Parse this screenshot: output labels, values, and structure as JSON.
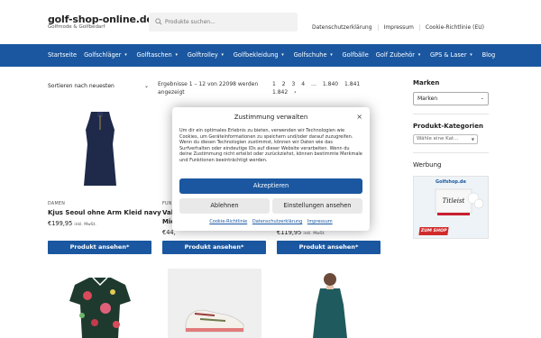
{
  "header": {
    "logo": "golf-shop-online.de",
    "tagline": "Golfmode & Golfbedarf",
    "search_placeholder": "Produkte suchen...",
    "links": [
      "Datenschutzerklärung",
      "Impressum",
      "Cookie-Richtlinie (EU)"
    ]
  },
  "nav": {
    "items": [
      {
        "label": "Startseite",
        "has_dropdown": false
      },
      {
        "label": "Golfschläger",
        "has_dropdown": true
      },
      {
        "label": "Golftaschen",
        "has_dropdown": true
      },
      {
        "label": "Golftrolley",
        "has_dropdown": true
      },
      {
        "label": "Golfbekleidung",
        "has_dropdown": true
      },
      {
        "label": "Golfschuhe",
        "has_dropdown": true
      },
      {
        "label": "Golfbälle",
        "has_dropdown": false
      },
      {
        "label": "Golf Zubehör",
        "has_dropdown": true
      },
      {
        "label": "GPS & Laser",
        "has_dropdown": true
      },
      {
        "label": "Blog",
        "has_dropdown": false
      }
    ]
  },
  "listing": {
    "sort_label": "Sortieren nach neuesten",
    "results_text": "Ergebnisse 1 – 12 von 22098 werden angezeigt",
    "pages": [
      "1",
      "2",
      "3",
      "4",
      "…",
      "1.840",
      "1.841",
      "1.842"
    ],
    "next": "›"
  },
  "products": [
    {
      "label": "DAMEN",
      "title": "Kjus Seoul ohne Arm Kleid navy",
      "price": "€199,95",
      "price_note": "inkl. MwSt.",
      "button": "Produkt ansehen*"
    },
    {
      "label": "FUN",
      "title": "Val",
      "title2": "Mic",
      "price": "€44,",
      "price_note": "",
      "button": "Produkt ansehen*"
    },
    {
      "label": "",
      "title": "",
      "price": "€119,95",
      "price_note": "inkl. MwSt.",
      "button": "Produkt ansehen*"
    }
  ],
  "sidebar": {
    "brand_heading": "Marken",
    "brand_select": "Marken",
    "cat_heading": "Produkt-Kategorien",
    "cat_select": "Wähle eine Kat…",
    "ad_heading": "Werbung",
    "ad_logo": "Golfshop.de",
    "ad_cta": "ZUM SHOP"
  },
  "consent": {
    "title": "Zustimmung verwalten",
    "close": "×",
    "body": "Um dir ein optimales Erlebnis zu bieten, verwenden wir Technologien wie Cookies, um Geräteinformationen zu speichern und/oder darauf zuzugreifen. Wenn du diesen Technologien zustimmst, können wir Daten wie das Surfverhalten oder eindeutige IDs auf dieser Website verarbeiten. Wenn du deine Zustimmung nicht erteilst oder zurückziehst, können bestimmte Merkmale und Funktionen beeinträchtigt werden.",
    "accept": "Akzeptieren",
    "deny": "Ablehnen",
    "settings": "Einstellungen ansehen",
    "links": [
      "Cookie-Richtlinie",
      "Datenschutzerklärung",
      "Impressum"
    ]
  },
  "colors": {
    "brand_blue": "#1a57a0"
  }
}
